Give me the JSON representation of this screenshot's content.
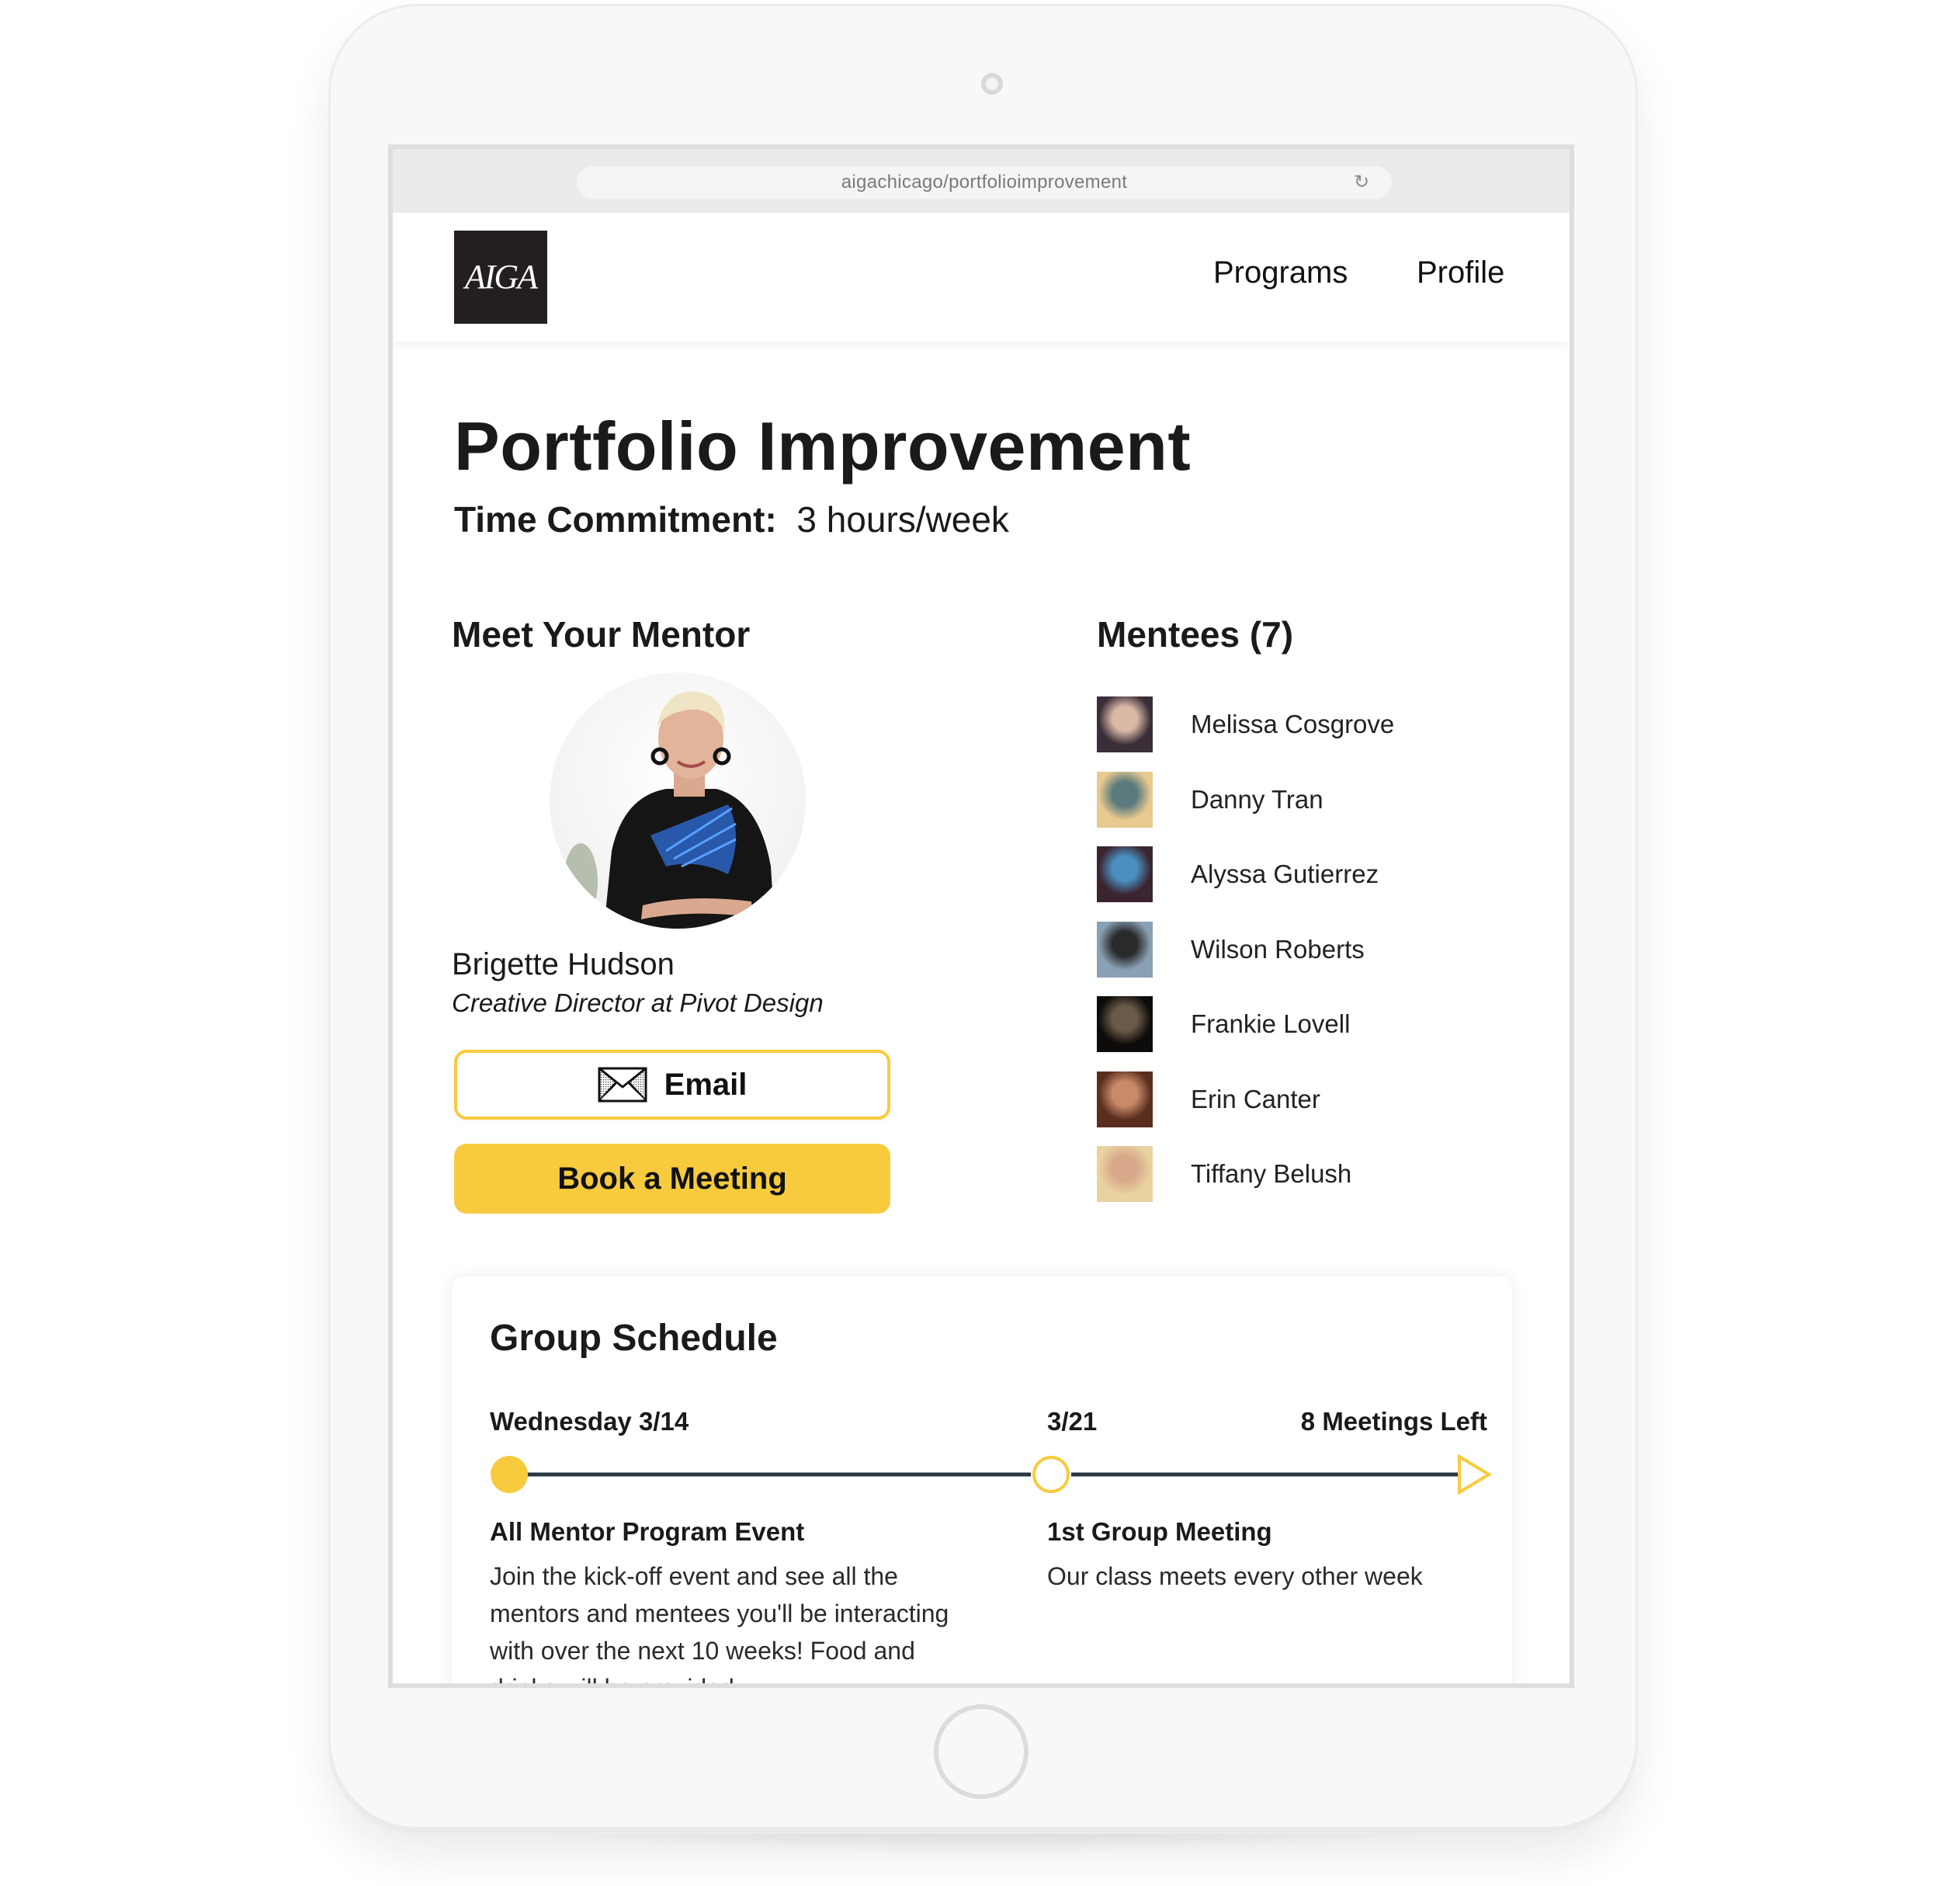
{
  "browser": {
    "url": "aigachicago/portfolioimprovement",
    "reload_icon": "reload-icon"
  },
  "nav": {
    "logo_text": "AIGA",
    "links": [
      {
        "label": "Programs"
      },
      {
        "label": "Profile"
      }
    ]
  },
  "page": {
    "title": "Portfolio Improvement",
    "commitment_label": "Time Commitment:",
    "commitment_value": "3 hours/week"
  },
  "mentor": {
    "heading": "Meet Your Mentor",
    "name": "Brigette Hudson",
    "role": "Creative Director at Pivot Design",
    "email_label": "Email",
    "email_icon": "envelope-icon",
    "book_label": "Book a Meeting"
  },
  "mentees": {
    "heading": "Mentees (7)",
    "items": [
      {
        "name": "Melissa Cosgrove",
        "avatar_colors": [
          "#3a2e38",
          "#d9b8a6"
        ]
      },
      {
        "name": "Danny Tran",
        "avatar_colors": [
          "#e8c98f",
          "#5a7a7e"
        ]
      },
      {
        "name": "Alyssa Gutierrez",
        "avatar_colors": [
          "#3b2530",
          "#4a8fbf"
        ]
      },
      {
        "name": "Wilson Roberts",
        "avatar_colors": [
          "#8aa0b4",
          "#2a2a2a"
        ]
      },
      {
        "name": "Frankie Lovell",
        "avatar_colors": [
          "#0e0c0a",
          "#6a5a48"
        ]
      },
      {
        "name": "Erin Canter",
        "avatar_colors": [
          "#5a2e1e",
          "#c98a6a"
        ]
      },
      {
        "name": "Tiffany Belush",
        "avatar_colors": [
          "#e8d2a0",
          "#d8a88a"
        ]
      }
    ]
  },
  "schedule": {
    "title": "Group Schedule",
    "start_date": "Wednesday 3/14",
    "next_date": "3/21",
    "remaining": "8 Meetings Left",
    "events": [
      {
        "title": "All Mentor Program Event",
        "body": "Join the kick-off event and see all the mentors and mentees you'll be interacting with over the next 10 weeks! Food and drinks will be provided"
      },
      {
        "title": "1st Group Meeting",
        "body": "Our class meets every other week"
      }
    ]
  },
  "colors": {
    "accent": "#f8cb3e",
    "timeline_line": "#253640",
    "text": "#1a1a1a"
  }
}
